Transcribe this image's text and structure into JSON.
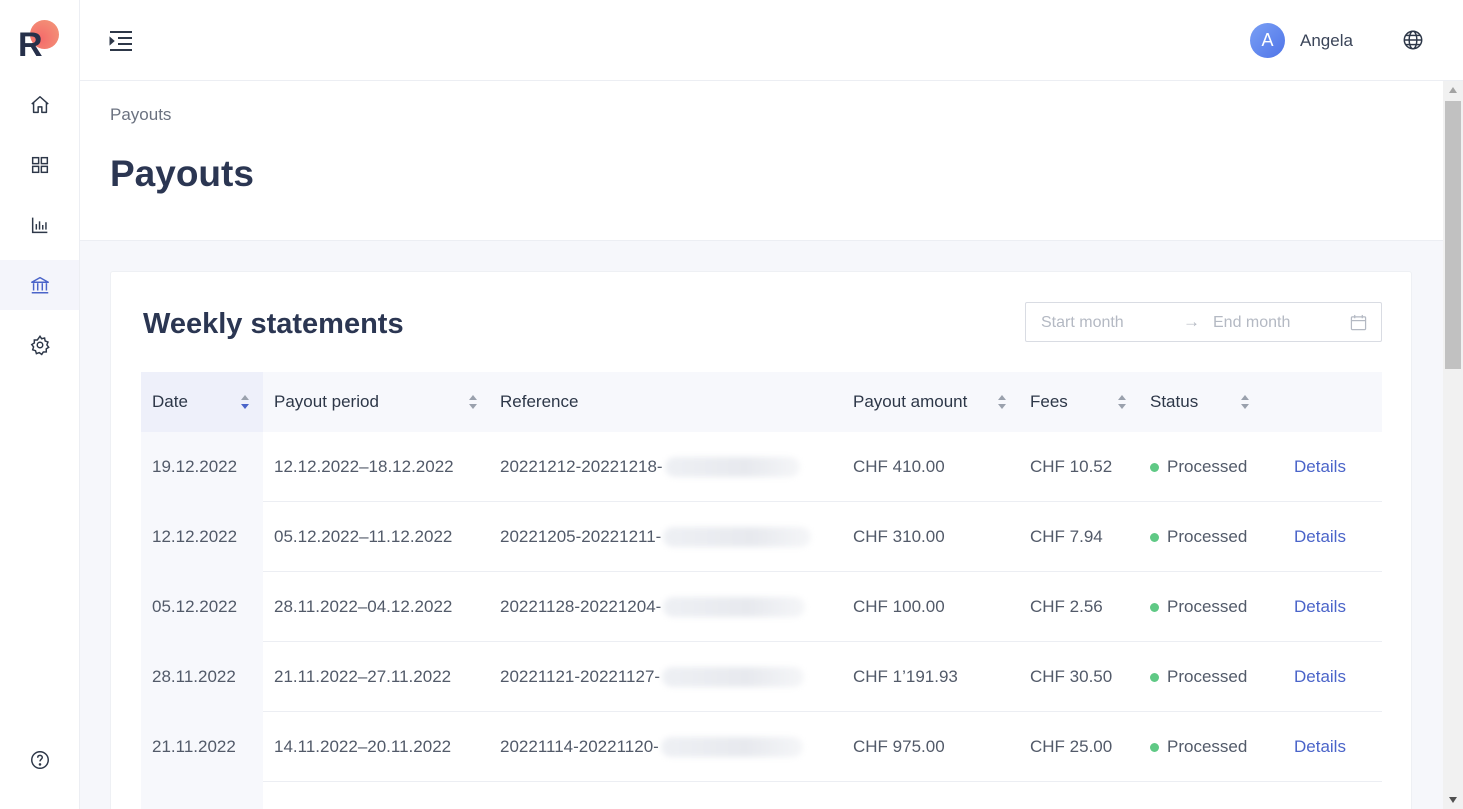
{
  "app": {
    "logo_letter": "R"
  },
  "colors": {
    "accent": "#4a64c9",
    "status_processed": "#5fc985",
    "title": "#2b3652"
  },
  "sidebar": {
    "items": [
      {
        "icon": "home-icon"
      },
      {
        "icon": "grid-icon"
      },
      {
        "icon": "bar-chart-icon"
      },
      {
        "icon": "bank-icon",
        "active": true
      },
      {
        "icon": "gear-icon"
      }
    ],
    "help_icon": "help-icon"
  },
  "header": {
    "avatar_initial": "A",
    "user_name": "Angela"
  },
  "page": {
    "breadcrumb": "Payouts",
    "title": "Payouts"
  },
  "card": {
    "title": "Weekly statements",
    "range": {
      "start_placeholder": "Start month",
      "arrow": "→",
      "end_placeholder": "End month"
    }
  },
  "table": {
    "columns": {
      "date": "Date",
      "period": "Payout period",
      "reference": "Reference",
      "amount": "Payout amount",
      "fees": "Fees",
      "status": "Status"
    },
    "rows": [
      {
        "date": "19.12.2022",
        "period": "12.12.2022–18.12.2022",
        "reference": "20221212-20221218-",
        "amount": "CHF 410.00",
        "fees": "CHF 10.52",
        "status": "Processed",
        "action": "Details"
      },
      {
        "date": "12.12.2022",
        "period": "05.12.2022–11.12.2022",
        "reference": "20221205-20221211-",
        "amount": "CHF 310.00",
        "fees": "CHF 7.94",
        "status": "Processed",
        "action": "Details"
      },
      {
        "date": "05.12.2022",
        "period": "28.11.2022–04.12.2022",
        "reference": "20221128-20221204-",
        "amount": "CHF 100.00",
        "fees": "CHF 2.56",
        "status": "Processed",
        "action": "Details"
      },
      {
        "date": "28.11.2022",
        "period": "21.11.2022–27.11.2022",
        "reference": "20221121-20221127-",
        "amount": "CHF 1’191.93",
        "fees": "CHF 30.50",
        "status": "Processed",
        "action": "Details"
      },
      {
        "date": "21.11.2022",
        "period": "14.11.2022–20.11.2022",
        "reference": "20221114-20221120-",
        "amount": "CHF 975.00",
        "fees": "CHF 25.00",
        "status": "Processed",
        "action": "Details"
      }
    ]
  }
}
